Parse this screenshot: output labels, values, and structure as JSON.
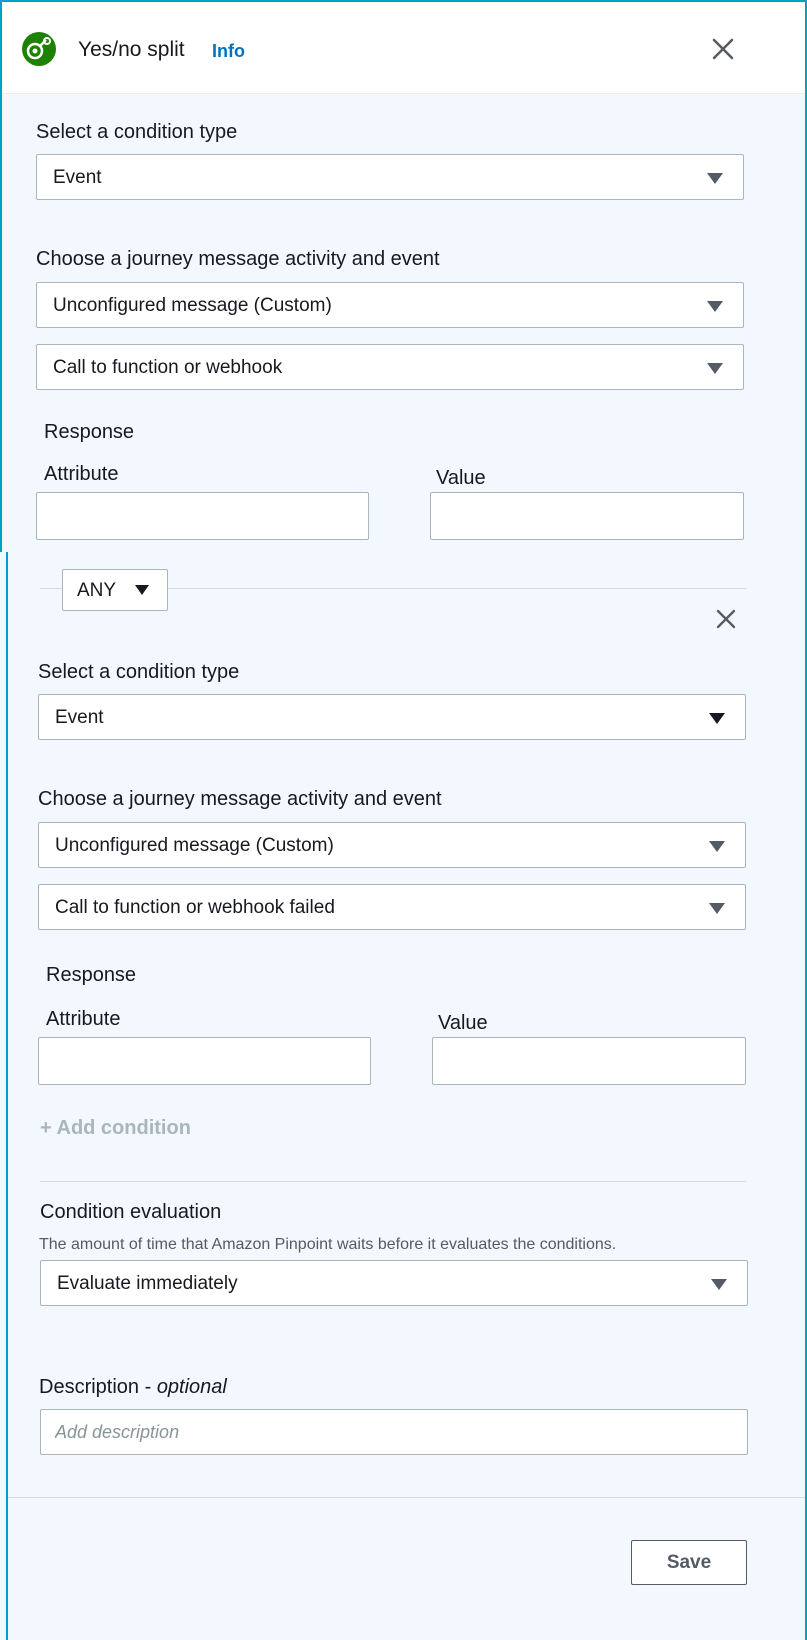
{
  "header": {
    "title": "Yes/no split",
    "info_link": "Info"
  },
  "condition1": {
    "type_label": "Select a condition type",
    "type_value": "Event",
    "activity_label": "Choose a journey message activity and event",
    "activity_value": "Unconfigured message (Custom)",
    "event_value": "Call to function or webhook",
    "response_label": "Response",
    "attribute_label": "Attribute",
    "value_label": "Value",
    "attribute_value": "",
    "value_value": ""
  },
  "operator": {
    "value": "ANY"
  },
  "condition2": {
    "type_label": "Select a condition type",
    "type_value": "Event",
    "activity_label": "Choose a journey message activity and event",
    "activity_value": "Unconfigured message (Custom)",
    "event_value": "Call to function or webhook failed",
    "response_label": "Response",
    "attribute_label": "Attribute",
    "value_label": "Value",
    "attribute_value": "",
    "value_value": ""
  },
  "add_condition": "+ Add condition",
  "evaluation": {
    "label": "Condition evaluation",
    "description": "The amount of time that Amazon Pinpoint waits before it evaluates the conditions.",
    "value": "Evaluate immediately"
  },
  "description_field": {
    "label": "Description - ",
    "label_optional": "optional",
    "placeholder": "Add description"
  },
  "footer": {
    "save_label": "Save"
  },
  "colors": {
    "accent": "#00a1c9",
    "link": "#0073bb",
    "icon": "#1d8102",
    "panel_bg": "#f2f8fd"
  }
}
